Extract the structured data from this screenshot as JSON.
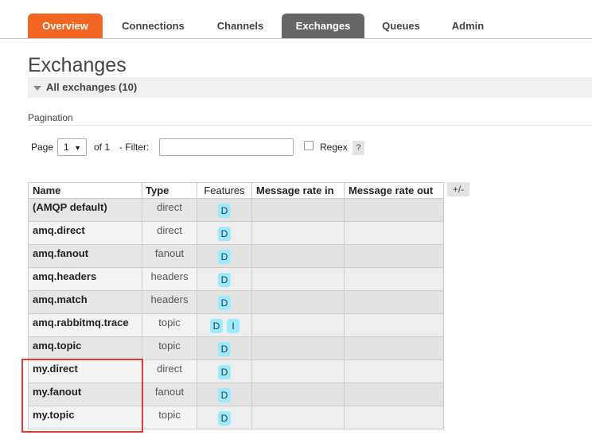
{
  "nav": {
    "tabs": [
      {
        "label": "Overview"
      },
      {
        "label": "Connections"
      },
      {
        "label": "Channels"
      },
      {
        "label": "Exchanges"
      },
      {
        "label": "Queues"
      },
      {
        "label": "Admin"
      }
    ],
    "active": "Exchanges",
    "accent_color": "#f26522",
    "active_color": "#666666"
  },
  "page_title": "Exchanges",
  "section": {
    "title": "All exchanges (10)",
    "icon": "collapse-triangle-icon"
  },
  "pagination": {
    "label": "Pagination",
    "page_label": "Page",
    "page_value": "1",
    "of_label": "of 1",
    "filter_label": "- Filter:",
    "filter_value": "",
    "regex_label": "Regex",
    "regex_checked": false,
    "help_label": "?"
  },
  "table": {
    "columns_toggle": "+/-",
    "headers": [
      "Name",
      "Type",
      "Features",
      "Message rate in",
      "Message rate out"
    ],
    "badge_color": "#99ebff",
    "rows": [
      {
        "name": "(AMQP default)",
        "type": "direct",
        "features": [
          "D"
        ],
        "rate_in": "",
        "rate_out": ""
      },
      {
        "name": "amq.direct",
        "type": "direct",
        "features": [
          "D"
        ],
        "rate_in": "",
        "rate_out": ""
      },
      {
        "name": "amq.fanout",
        "type": "fanout",
        "features": [
          "D"
        ],
        "rate_in": "",
        "rate_out": ""
      },
      {
        "name": "amq.headers",
        "type": "headers",
        "features": [
          "D"
        ],
        "rate_in": "",
        "rate_out": ""
      },
      {
        "name": "amq.match",
        "type": "headers",
        "features": [
          "D"
        ],
        "rate_in": "",
        "rate_out": ""
      },
      {
        "name": "amq.rabbitmq.trace",
        "type": "topic",
        "features": [
          "D",
          "I"
        ],
        "rate_in": "",
        "rate_out": ""
      },
      {
        "name": "amq.topic",
        "type": "topic",
        "features": [
          "D"
        ],
        "rate_in": "",
        "rate_out": ""
      },
      {
        "name": "my.direct",
        "type": "direct",
        "features": [
          "D"
        ],
        "rate_in": "",
        "rate_out": ""
      },
      {
        "name": "my.fanout",
        "type": "fanout",
        "features": [
          "D"
        ],
        "rate_in": "",
        "rate_out": ""
      },
      {
        "name": "my.topic",
        "type": "topic",
        "features": [
          "D"
        ],
        "rate_in": "",
        "rate_out": ""
      }
    ]
  },
  "highlight_color": "#e53935"
}
